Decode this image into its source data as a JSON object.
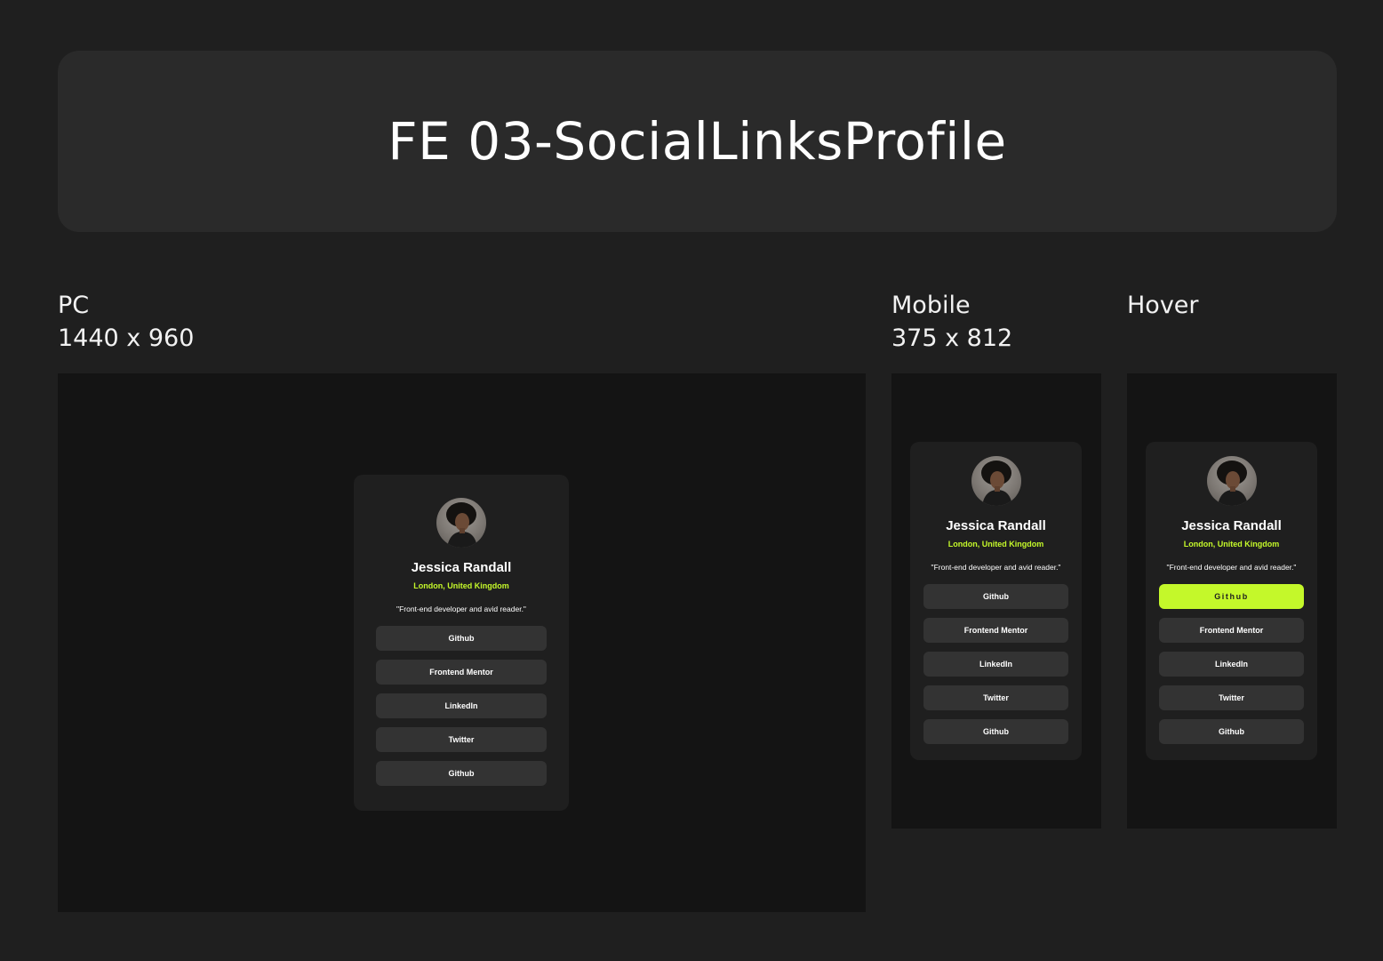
{
  "banner": {
    "title": "FE 03-SocialLinksProfile"
  },
  "frames": {
    "pc": {
      "label": "PC",
      "size": "1440 x 960"
    },
    "mobile": {
      "label": "Mobile",
      "size": "375 x 812"
    },
    "hover": {
      "label": "Hover"
    }
  },
  "profile": {
    "name": "Jessica Randall",
    "location": "London, United Kingdom",
    "bio": "\"Front-end developer and avid reader.\"",
    "links": [
      "Github",
      "Frontend Mentor",
      "LinkedIn",
      "Twitter",
      "Github"
    ]
  },
  "hover_state": {
    "hovered_index": 0
  },
  "colors": {
    "accent": "#c4f82a",
    "card": "#1f1f1f",
    "button": "#333333",
    "frame_bg": "#141414",
    "page_bg": "#1f1f1f"
  },
  "icons": {
    "avatar": "profile-photo"
  }
}
